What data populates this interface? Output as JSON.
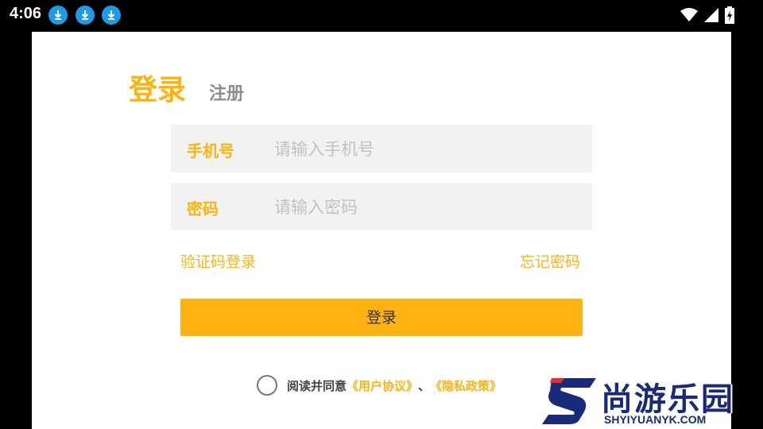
{
  "status_bar": {
    "time": "4:06",
    "icons": [
      "download-icon",
      "download-icon",
      "download-icon",
      "wifi-icon",
      "signal-icon",
      "battery-icon"
    ]
  },
  "tabs": {
    "login": "登录",
    "register": "注册"
  },
  "phone_field": {
    "label": "手机号",
    "placeholder": "请输入手机号",
    "value": ""
  },
  "password_field": {
    "label": "密码",
    "placeholder": "请输入密码",
    "value": ""
  },
  "links": {
    "sms_login": "验证码登录",
    "forgot_password": "忘记密码"
  },
  "login_button": "登录",
  "agreement": {
    "prefix": "阅读并同意",
    "user_agreement": "《用户协议》",
    "separator": "、",
    "privacy_policy": "《隐私政策》"
  },
  "watermark": {
    "name": "尚游乐园",
    "url": "SHYIYUANYK.COM"
  },
  "colors": {
    "accent": "#FFB310",
    "field_bg": "#f2f2f2",
    "placeholder": "#c2c2c2",
    "download_badge": "#1e9be8"
  }
}
